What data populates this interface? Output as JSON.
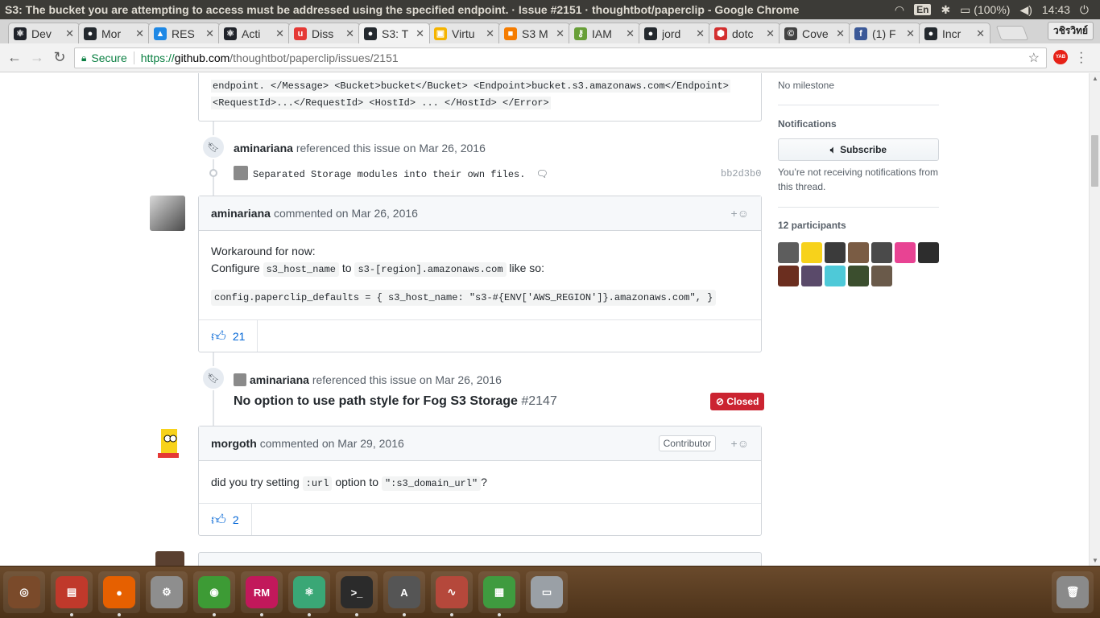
{
  "os": {
    "window_title": "S3: The bucket you are attempting to access must be addressed using the specified endpoint. · Issue #2151 · thoughtbot/paperclip - Google Chrome",
    "lang": "En",
    "battery": "(100%)",
    "time": "14:43"
  },
  "tabs": [
    {
      "label": "Dev",
      "color": "#20232a",
      "glyph": "⚛"
    },
    {
      "label": "Mor",
      "color": "#24292e",
      "glyph": "●"
    },
    {
      "label": "RES",
      "color": "#1e88e5",
      "glyph": "▲"
    },
    {
      "label": "Acti",
      "color": "#20232a",
      "glyph": "⚛"
    },
    {
      "label": "Diss",
      "color": "#e53935",
      "glyph": "u"
    },
    {
      "label": "S3: T",
      "color": "#24292e",
      "glyph": "●"
    },
    {
      "label": "Virtu",
      "color": "#f5b400",
      "glyph": "▣"
    },
    {
      "label": "S3 M",
      "color": "#f57c00",
      "glyph": "■"
    },
    {
      "label": "IAM",
      "color": "#689f38",
      "glyph": "⚷"
    },
    {
      "label": "jord",
      "color": "#24292e",
      "glyph": "●"
    },
    {
      "label": "dotc",
      "color": "#d32f2f",
      "glyph": "⬢"
    },
    {
      "label": "Cove",
      "color": "#424242",
      "glyph": "©"
    },
    {
      "label": "(1) F",
      "color": "#3b5998",
      "glyph": "f"
    },
    {
      "label": "Incr",
      "color": "#24292e",
      "glyph": "●"
    }
  ],
  "active_tab_index": 5,
  "profile_name": "วชิรวิทย์",
  "address": {
    "secure_label": "Secure",
    "proto": "https://",
    "host": "github.com",
    "path": "/thoughtbot/paperclip/issues/2151"
  },
  "extension_label": "YAB",
  "code_tail": {
    "line1": "endpoint. </Message> <Bucket>bucket</Bucket> <Endpoint>bucket.s3.amazonaws.com</Endpoint>",
    "line2": "<RequestId>...</RequestId> <HostId> ... </HostId> </Error>"
  },
  "event1": {
    "user": "aminariana",
    "text": "referenced this issue",
    "date": "on Mar 26, 2016",
    "commit_message": "Separated Storage modules into their own files.",
    "sha": "bb2d3b0"
  },
  "comment1": {
    "author": "aminariana",
    "action": "commented",
    "date": "on Mar 26, 2016",
    "line1": "Workaround for now:",
    "line2_a": "Configure",
    "code_a": "s3_host_name",
    "line2_b": "to",
    "code_b": "s3-[region].amazonaws.com",
    "line2_c": "like so:",
    "snippet": "config.paperclip_defaults = { s3_host_name: \"s3-#{ENV['AWS_REGION']}.amazonaws.com\", }",
    "thumbs_count": "21"
  },
  "event2": {
    "user": "aminariana",
    "text": "referenced this issue",
    "date": "on Mar 26, 2016",
    "issue_title": "No option to use path style for Fog S3 Storage",
    "issue_number": "#2147",
    "state": "Closed"
  },
  "comment2": {
    "author": "morgoth",
    "action": "commented",
    "date": "on Mar 29, 2016",
    "role": "Contributor",
    "text_a": "did you try setting",
    "code_a": ":url",
    "text_b": "option to",
    "code_b": "\":s3_domain_url\"",
    "text_c": "?",
    "thumbs_count": "2"
  },
  "sidebar": {
    "milestone": "No milestone",
    "notifications_heading": "Notifications",
    "subscribe_label": "Subscribe",
    "notif_note": "You’re not receiving notifications from this thread.",
    "participants_heading": "12 participants",
    "participant_colors": [
      "#5d5d5d",
      "#f7d21b",
      "#3b3b3b",
      "#7a5c44",
      "#4a4a4a",
      "#e84393",
      "#2d2d2d",
      "#6b2e1f",
      "#5a4a6a",
      "#4ec9d8",
      "#3b4e2e",
      "#6a5a4a"
    ]
  },
  "dock": [
    {
      "name": "ubuntu-dash",
      "color": "#7a4a2a",
      "glyph": "◎"
    },
    {
      "name": "files",
      "color": "#c0392b",
      "glyph": "▤"
    },
    {
      "name": "firefox",
      "color": "#e66000",
      "glyph": "●"
    },
    {
      "name": "settings",
      "color": "#8e8e8e",
      "glyph": "⚙"
    },
    {
      "name": "chrome",
      "color": "#3d9b35",
      "glyph": "◉"
    },
    {
      "name": "rubymine",
      "color": "#c2185b",
      "glyph": "RM"
    },
    {
      "name": "atom",
      "color": "#3aa776",
      "glyph": "⚛"
    },
    {
      "name": "terminal",
      "color": "#2b2b2b",
      "glyph": ">_"
    },
    {
      "name": "software-updater",
      "color": "#555555",
      "glyph": "A"
    },
    {
      "name": "system-monitor",
      "color": "#b5483b",
      "glyph": "∿"
    },
    {
      "name": "spreadsheet",
      "color": "#3f9b3f",
      "glyph": "▦"
    },
    {
      "name": "disk",
      "color": "#9aa0a6",
      "glyph": "▭"
    },
    {
      "name": "trash",
      "color": "#8a8a8a",
      "glyph": "🗑"
    }
  ]
}
